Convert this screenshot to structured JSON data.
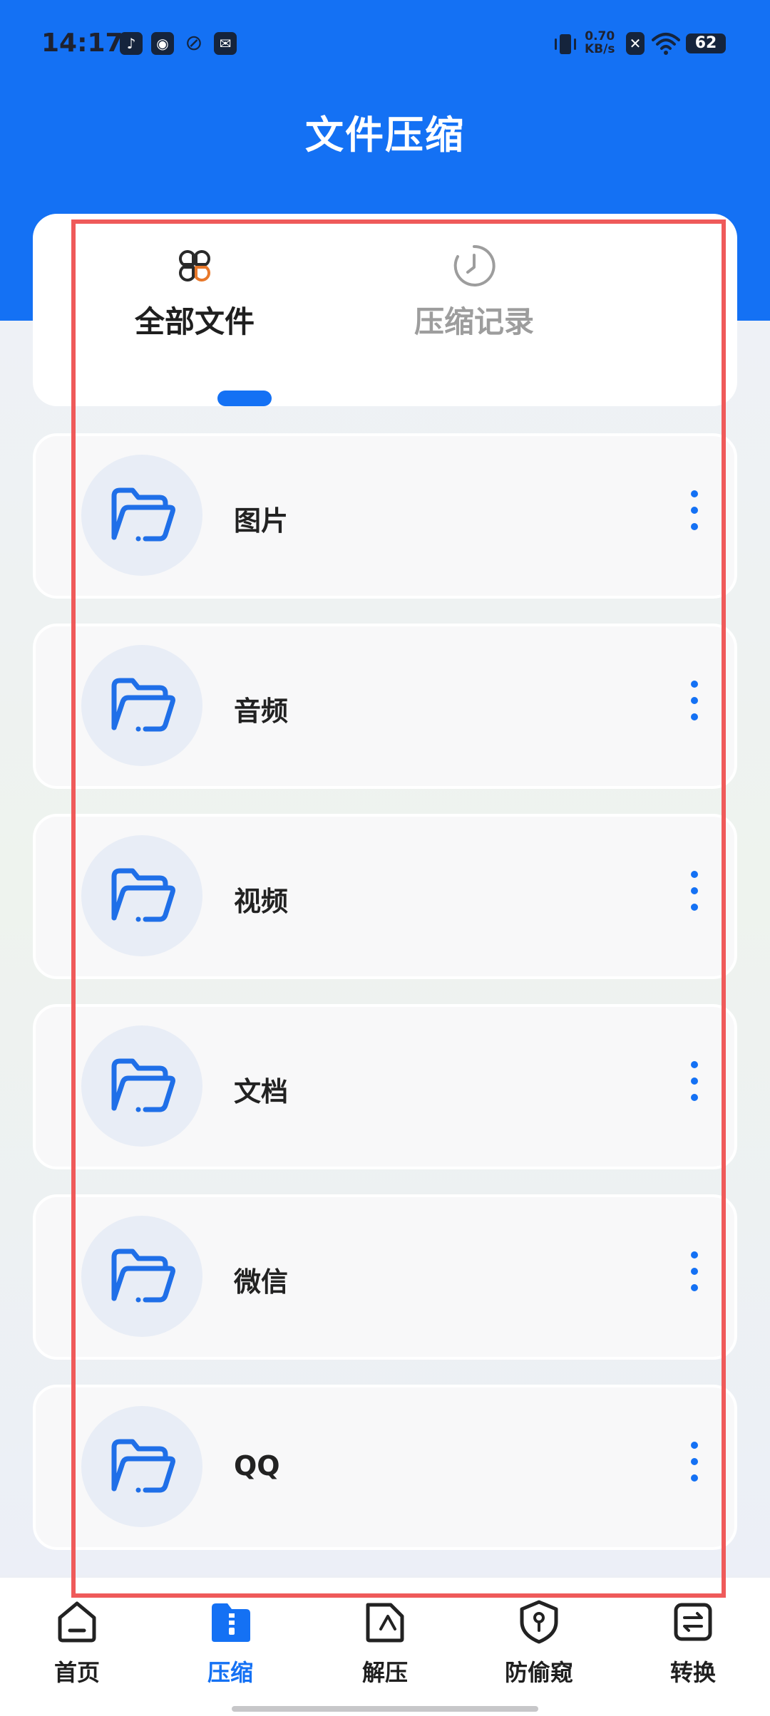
{
  "status_bar": {
    "time": "14:17",
    "net_speed_value": "0.70",
    "net_speed_unit": "KB/s",
    "battery": "62"
  },
  "header": {
    "title": "文件压缩"
  },
  "tabs": [
    {
      "label": "全部文件",
      "icon": "clover-icon",
      "active": true
    },
    {
      "label": "压缩记录",
      "icon": "clock-icon",
      "active": false
    }
  ],
  "folders": [
    {
      "label": "图片",
      "icon": "folder-icon"
    },
    {
      "label": "音频",
      "icon": "folder-icon"
    },
    {
      "label": "视频",
      "icon": "folder-icon"
    },
    {
      "label": "文档",
      "icon": "folder-icon"
    },
    {
      "label": "微信",
      "icon": "folder-icon"
    },
    {
      "label": "QQ",
      "icon": "folder-icon"
    }
  ],
  "bottom_nav": [
    {
      "label": "首页",
      "icon": "home-icon",
      "active": false
    },
    {
      "label": "压缩",
      "icon": "zip-icon",
      "active": true
    },
    {
      "label": "解压",
      "icon": "unzip-icon",
      "active": false
    },
    {
      "label": "防偷窥",
      "icon": "shield-icon",
      "active": false
    },
    {
      "label": "转换",
      "icon": "convert-icon",
      "active": false
    }
  ],
  "colors": {
    "primary": "#1471F4",
    "accent_orange": "#E8782A",
    "highlight_red": "#EF5A5A"
  }
}
